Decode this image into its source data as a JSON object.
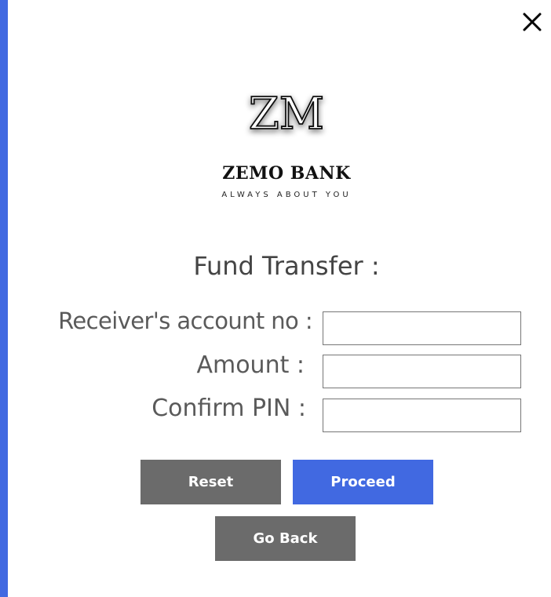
{
  "window": {
    "close_icon": "close-icon"
  },
  "brand": {
    "logo_text": "ZM",
    "name": "ZEMO BANK",
    "tagline": "ALWAYS ABOUT YOU",
    "accent_color": "#4169e1"
  },
  "form": {
    "title": "Fund Transfer :",
    "fields": [
      {
        "label": "Receiver's account no :",
        "value": "",
        "placeholder": ""
      },
      {
        "label": "Amount :",
        "value": "",
        "placeholder": ""
      },
      {
        "label": "Confirm PIN :",
        "value": "",
        "placeholder": ""
      }
    ]
  },
  "actions": {
    "reset_label": "Reset",
    "proceed_label": "Proceed",
    "go_back_label": "Go Back",
    "primary_color": "#4169e1",
    "secondary_color": "#6b6b6b"
  }
}
